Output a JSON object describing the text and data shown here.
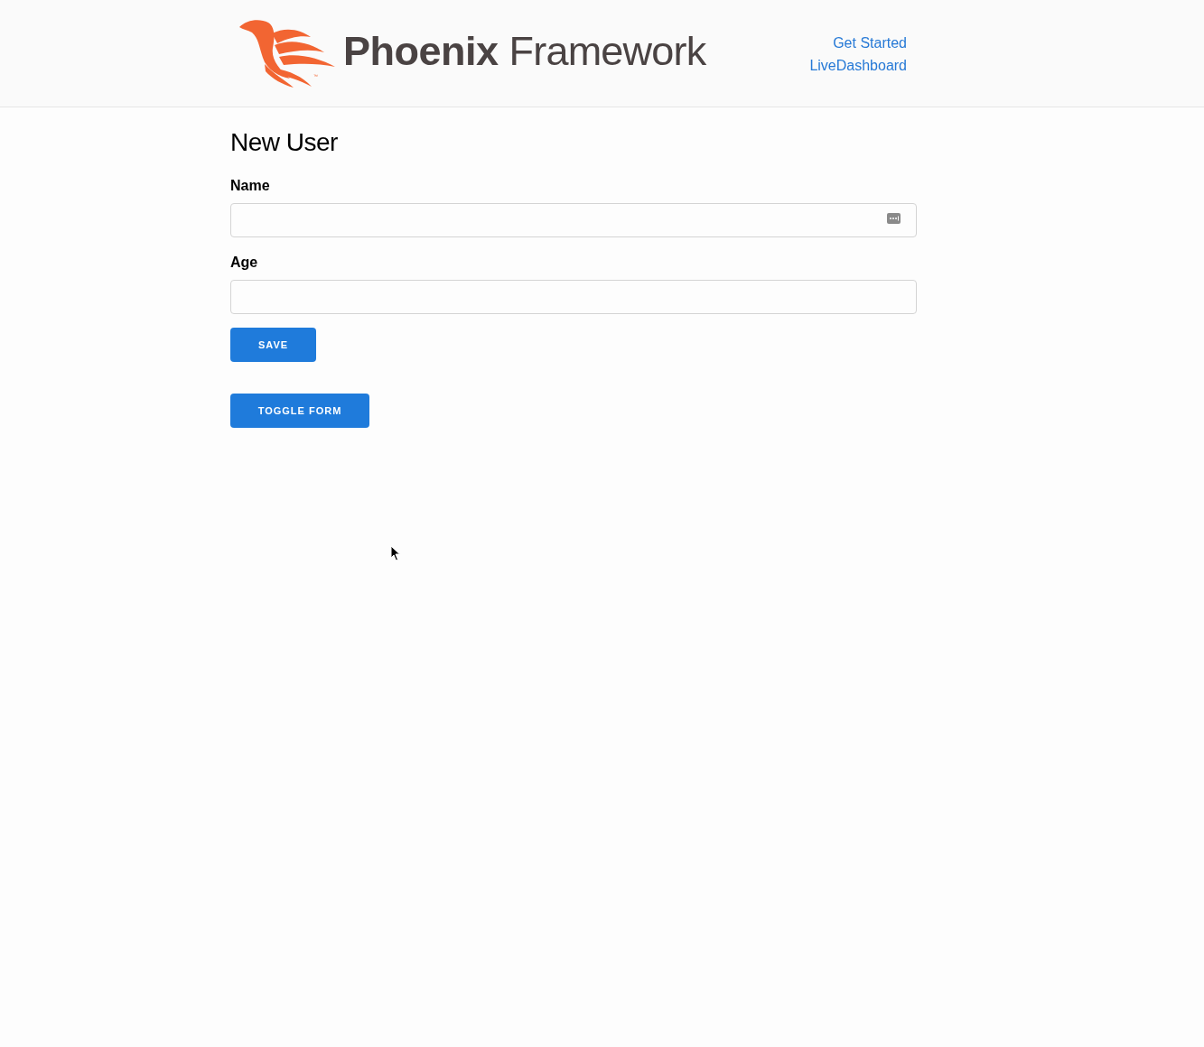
{
  "header": {
    "logo": {
      "word_1": "Phoenix",
      "word_2": "Framework",
      "trademark": "™"
    },
    "nav_links": [
      "Get Started",
      "LiveDashboard"
    ]
  },
  "form": {
    "title": "New User",
    "fields": [
      {
        "label": "Name",
        "autofill_icon": true
      },
      {
        "label": "Age",
        "autofill_icon": false
      }
    ],
    "submit_button": "SAVE"
  },
  "toggle_button": "TOGGLE FORM"
}
